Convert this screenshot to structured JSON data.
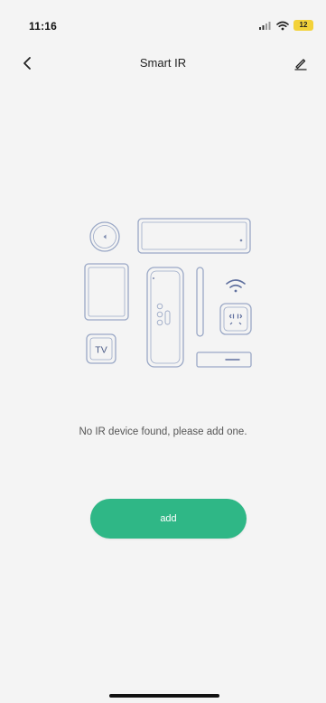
{
  "status_bar": {
    "time": "11:16",
    "battery": "12"
  },
  "nav": {
    "title": "Smart IR"
  },
  "illustration": {
    "tv_label": "TV"
  },
  "empty_state": {
    "message": "No IR device found, please add one."
  },
  "actions": {
    "add_label": "add"
  },
  "colors": {
    "accent": "#2fb786",
    "line": "#9aa8c6",
    "background": "#f4f4f4",
    "battery": "#f3d23a"
  }
}
